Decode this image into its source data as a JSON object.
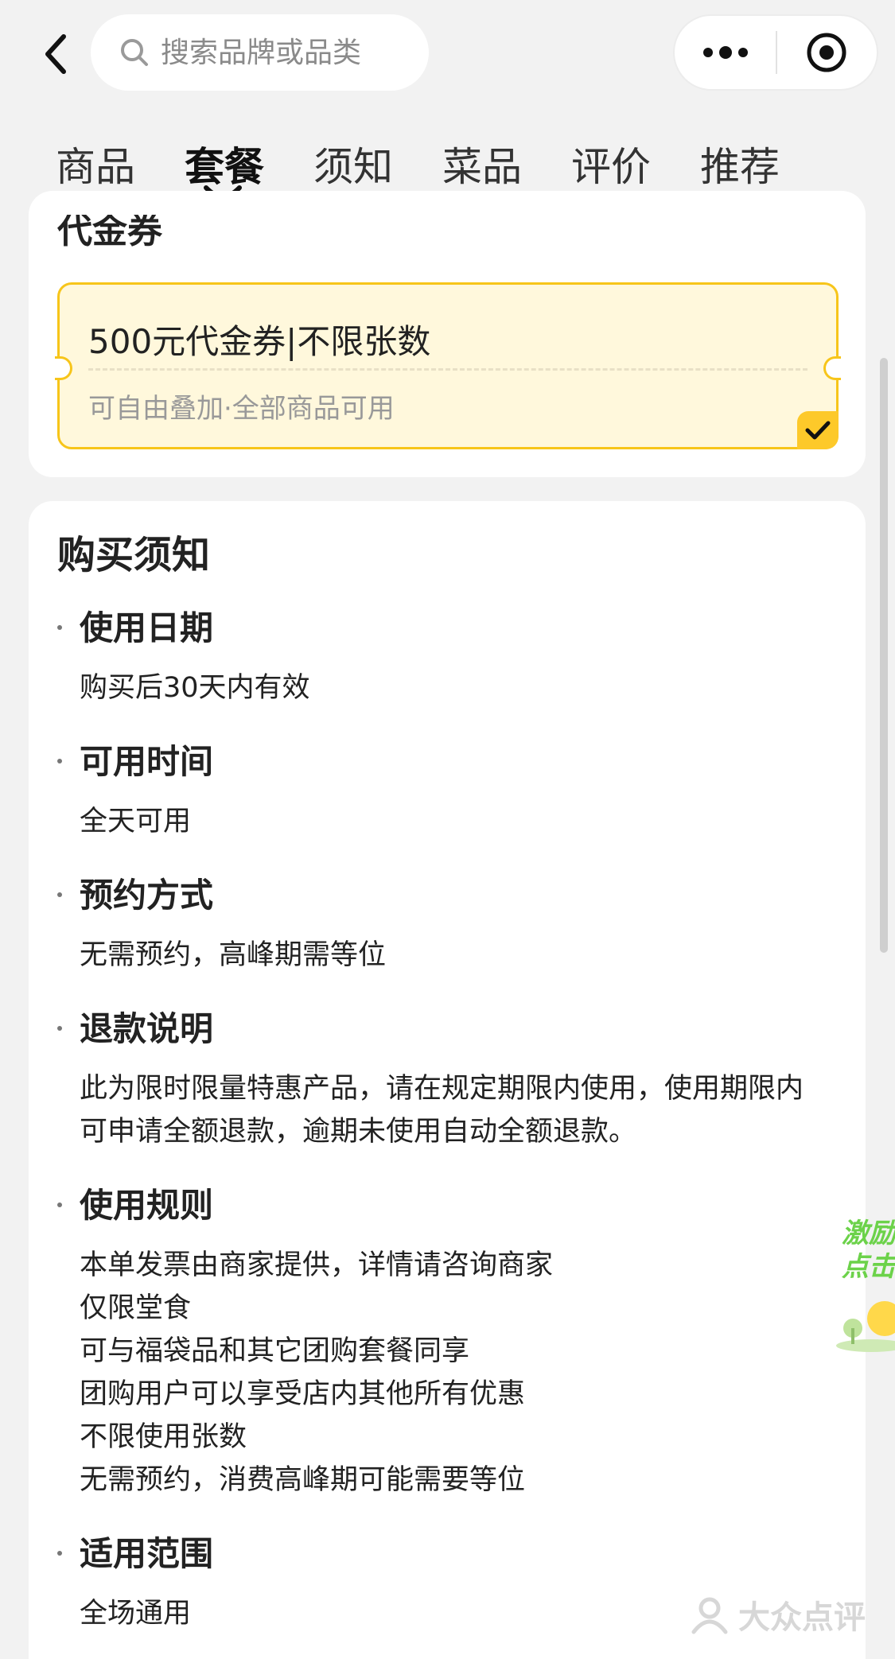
{
  "header": {
    "search_placeholder": "搜索品牌或品类"
  },
  "tabs": [
    {
      "label": "商品"
    },
    {
      "label": "套餐"
    },
    {
      "label": "须知"
    },
    {
      "label": "菜品"
    },
    {
      "label": "评价"
    },
    {
      "label": "推荐"
    }
  ],
  "active_tab": "套餐",
  "voucher_card": {
    "title": "代金券",
    "voucher": {
      "name": "500元代金券|不限张数",
      "desc": "可自由叠加·全部商品可用",
      "selected": true
    }
  },
  "notice": {
    "title": "购买须知",
    "sections": [
      {
        "heading": "使用日期",
        "lines": [
          "购买后30天内有效"
        ]
      },
      {
        "heading": "可用时间",
        "lines": [
          "全天可用"
        ]
      },
      {
        "heading": "预约方式",
        "lines": [
          "无需预约，高峰期需等位"
        ]
      },
      {
        "heading": "退款说明",
        "lines": [
          "此为限时限量特惠产品，请在规定期限内使用，使用期限内",
          "可申请全额退款，逾期未使用自动全额退款。"
        ]
      },
      {
        "heading": "使用规则",
        "lines": [
          "本单发票由商家提供，详情请咨询商家",
          "仅限堂食",
          "可与福袋品和其它团购套餐同享",
          "团购用户可以享受店内其他所有优惠",
          "不限使用张数",
          "无需预约，消费高峰期可能需要等位"
        ]
      },
      {
        "heading": "适用范围",
        "lines": [
          "全场通用"
        ]
      }
    ]
  },
  "promo": {
    "line1": "激励",
    "line2": "点击"
  },
  "watermark": {
    "text": "大众点评"
  },
  "colors": {
    "accent": "#f7c51a",
    "voucher_bg": "#fff8dc",
    "check_bg": "#fdc92a",
    "page_bg": "#f2f2f2"
  }
}
